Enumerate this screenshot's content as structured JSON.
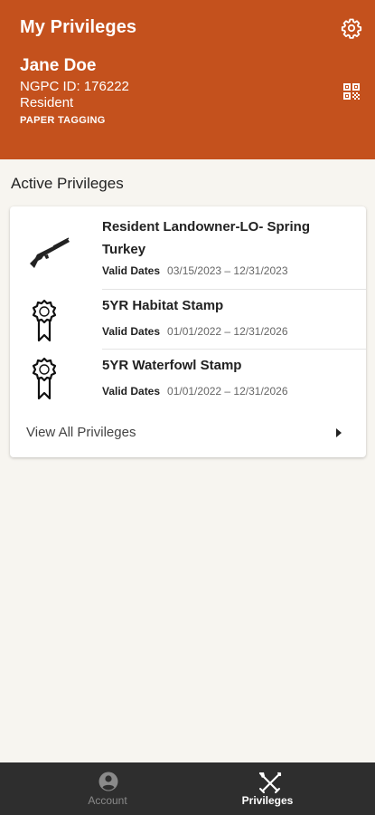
{
  "header": {
    "title": "My Privileges",
    "settings_icon": "gear-icon",
    "qr_icon": "qr-code-icon",
    "name": "Jane Doe",
    "ngpc_id": "NGPC ID: 176222",
    "residency": "Resident",
    "tagging": "PAPER TAGGING",
    "background_color": "#c4511d"
  },
  "section": {
    "title": "Active Privileges"
  },
  "privileges": [
    {
      "icon": "shotgun-icon",
      "name": "Resident Landowner-LO- Spring Turkey",
      "dates_label": "Valid Dates",
      "dates": "03/15/2023 – 12/31/2023"
    },
    {
      "icon": "ribbon-badge-icon",
      "name": "5YR Habitat Stamp",
      "dates_label": "Valid Dates",
      "dates": "01/01/2022 – 12/31/2026"
    },
    {
      "icon": "ribbon-badge-icon",
      "name": "5YR Waterfowl Stamp",
      "dates_label": "Valid Dates",
      "dates": "01/01/2022 – 12/31/2026"
    }
  ],
  "view_all": {
    "label": "View All Privileges",
    "icon": "chevron-right-icon"
  },
  "bottom_nav": {
    "account": {
      "label": "Account",
      "icon": "account-circle-icon"
    },
    "privileges": {
      "label": "Privileges",
      "icon": "crossed-tools-icon",
      "active": true
    }
  }
}
